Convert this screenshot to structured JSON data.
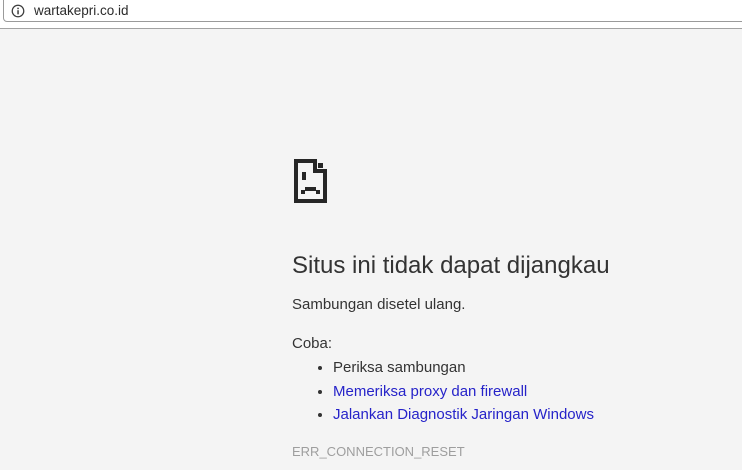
{
  "browser": {
    "url": "wartakepri.co.id"
  },
  "error_page": {
    "title": "Situs ini tidak dapat dijangkau",
    "message": "Sambungan disetel ulang.",
    "suggestions_label": "Coba:",
    "suggestions": [
      {
        "label": "Periksa sambungan",
        "is_link": false
      },
      {
        "label": "Memeriksa proxy dan firewall",
        "is_link": true
      },
      {
        "label": "Jalankan Diagnostik Jaringan Windows",
        "is_link": true
      }
    ],
    "error_code": "ERR_CONNECTION_RESET"
  },
  "icons": {
    "omnibox_icon": "info-icon",
    "page_icon": "sad-file-icon"
  },
  "colors": {
    "page_background": "#f4f4f4",
    "toolbar_background": "#ffffff",
    "omnibox_border": "#9a9a9a",
    "toolbar_divider": "#a2a2a2",
    "text": "#333333",
    "link": "#2623c9",
    "error_code_text": "#9e9e9e",
    "icon": "#262626"
  }
}
